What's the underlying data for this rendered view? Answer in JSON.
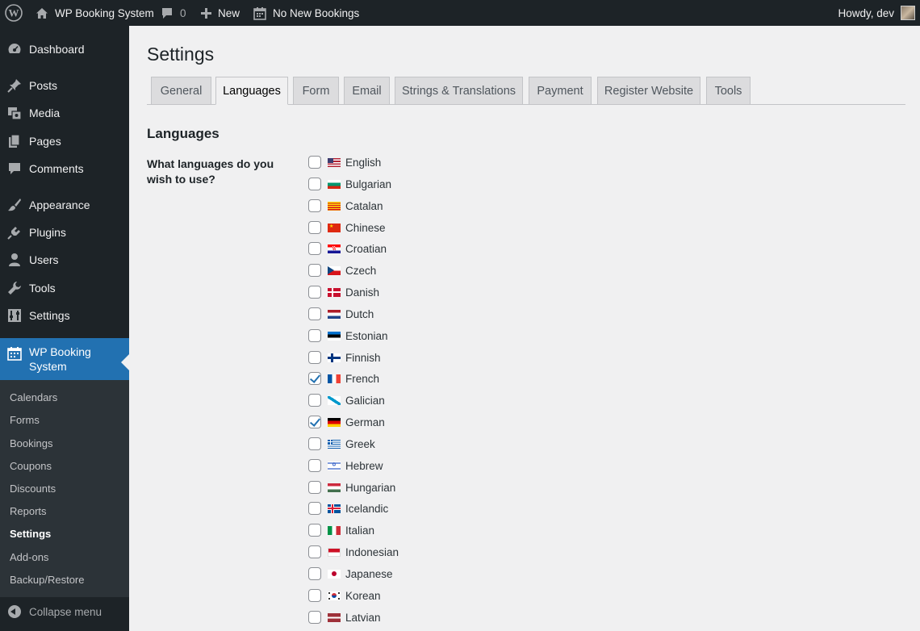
{
  "admin_bar": {
    "site_name": "WP Booking System",
    "comments_count": "0",
    "new_label": "New",
    "bookings_label": "No New Bookings",
    "howdy": "Howdy, dev"
  },
  "sidebar": {
    "items": [
      {
        "label": "Dashboard",
        "icon": "dashboard-icon"
      },
      {
        "label": "Posts",
        "icon": "pin-icon"
      },
      {
        "label": "Media",
        "icon": "media-icon"
      },
      {
        "label": "Pages",
        "icon": "pages-icon"
      },
      {
        "label": "Comments",
        "icon": "comment-icon"
      },
      {
        "label": "Appearance",
        "icon": "brush-icon"
      },
      {
        "label": "Plugins",
        "icon": "plug-icon"
      },
      {
        "label": "Users",
        "icon": "user-icon"
      },
      {
        "label": "Tools",
        "icon": "wrench-icon"
      },
      {
        "label": "Settings",
        "icon": "settings-icon"
      }
    ],
    "current": {
      "label_line1": "WP Booking",
      "label_line2": "System",
      "icon": "calendar-icon"
    },
    "submenu": [
      "Calendars",
      "Forms",
      "Bookings",
      "Coupons",
      "Discounts",
      "Reports",
      "Settings",
      "Add-ons",
      "Backup/Restore"
    ],
    "submenu_current": "Settings",
    "collapse_label": "Collapse menu"
  },
  "page": {
    "title": "Settings",
    "tabs": [
      "General",
      "Languages",
      "Form",
      "Email",
      "Strings & Translations",
      "Payment",
      "Register Website",
      "Tools"
    ],
    "active_tab": "Languages",
    "section_heading": "Languages",
    "field_label": "What languages do you wish to use?"
  },
  "languages": [
    {
      "name": "English",
      "checked": false
    },
    {
      "name": "Bulgarian",
      "checked": false
    },
    {
      "name": "Catalan",
      "checked": false
    },
    {
      "name": "Chinese",
      "checked": false
    },
    {
      "name": "Croatian",
      "checked": false
    },
    {
      "name": "Czech",
      "checked": false
    },
    {
      "name": "Danish",
      "checked": false
    },
    {
      "name": "Dutch",
      "checked": false
    },
    {
      "name": "Estonian",
      "checked": false
    },
    {
      "name": "Finnish",
      "checked": false
    },
    {
      "name": "French",
      "checked": true
    },
    {
      "name": "Galician",
      "checked": false
    },
    {
      "name": "German",
      "checked": true
    },
    {
      "name": "Greek",
      "checked": false
    },
    {
      "name": "Hebrew",
      "checked": false
    },
    {
      "name": "Hungarian",
      "checked": false
    },
    {
      "name": "Icelandic",
      "checked": false
    },
    {
      "name": "Italian",
      "checked": false
    },
    {
      "name": "Indonesian",
      "checked": false
    },
    {
      "name": "Japanese",
      "checked": false
    },
    {
      "name": "Korean",
      "checked": false
    },
    {
      "name": "Latvian",
      "checked": false
    }
  ],
  "colors": {
    "admin_bar_bg": "#1d2327",
    "accent": "#2271b1",
    "page_bg": "#f0f0f1"
  }
}
